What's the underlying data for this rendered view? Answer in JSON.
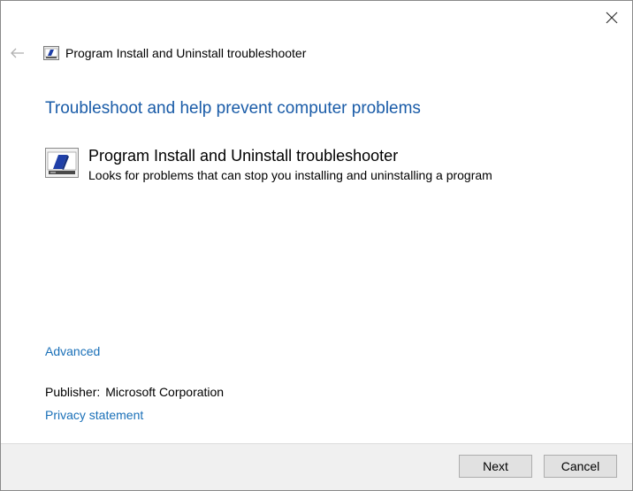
{
  "window": {
    "close_icon": "close-icon",
    "back_icon": "back-arrow-icon"
  },
  "titlebar": {
    "title": "Program Install and Uninstall troubleshooter",
    "icon": "troubleshooter-icon"
  },
  "main": {
    "heading": "Troubleshoot and help prevent computer problems",
    "item": {
      "icon": "program-installer-icon",
      "title": "Program Install and Uninstall troubleshooter",
      "description": "Looks for problems that can stop you installing and uninstalling a program"
    },
    "advanced_label": "Advanced",
    "publisher_label": "Publisher:",
    "publisher_value": "Microsoft Corporation",
    "privacy_label": "Privacy statement"
  },
  "footer": {
    "next_label": "Next",
    "cancel_label": "Cancel"
  },
  "colors": {
    "heading": "#1a5ca8",
    "link": "#1a70b8",
    "footer_bg": "#f0f0f0",
    "button_bg": "#e1e1e1"
  }
}
